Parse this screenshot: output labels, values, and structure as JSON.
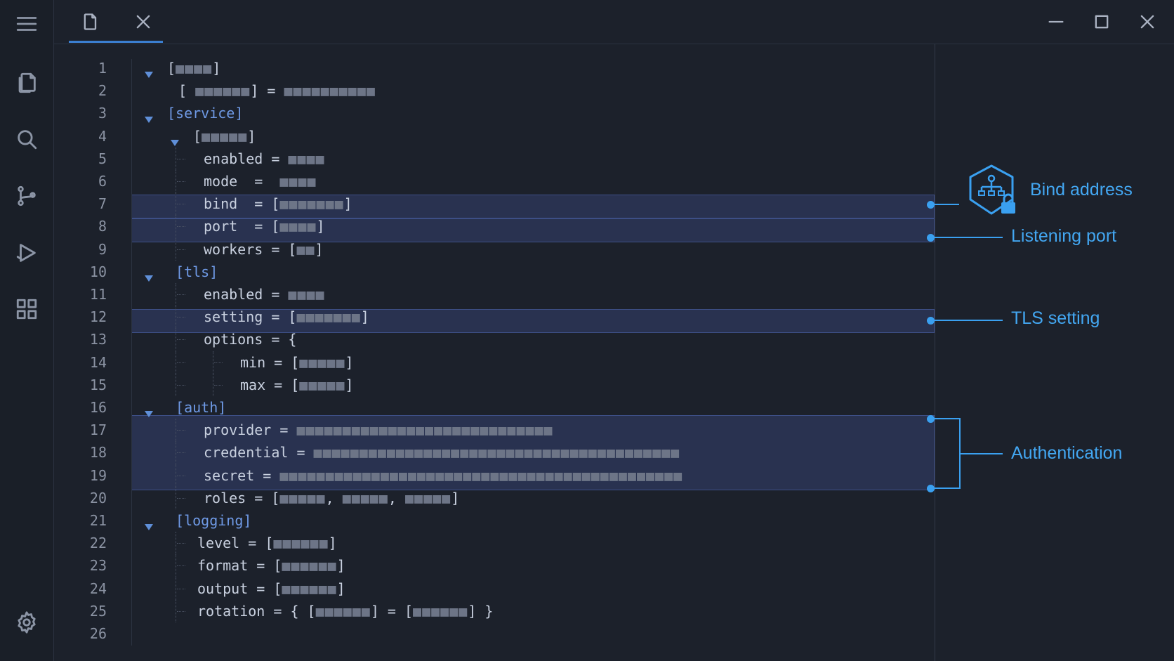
{
  "editor": {
    "lines": [
      {
        "n": "1",
        "indent": 0,
        "fold": true,
        "parts": [
          [
            "t",
            "["
          ],
          [
            "m",
            "■■■■"
          ],
          [
            "t",
            "]"
          ]
        ]
      },
      {
        "n": "2",
        "indent": 1,
        "fold": false,
        "parts": [
          [
            "t",
            "[ "
          ],
          [
            "m",
            "■■■■■■"
          ],
          [
            "t",
            "] = "
          ],
          [
            "m",
            "■■■■■■■■■■"
          ]
        ]
      },
      {
        "n": "3",
        "indent": 0,
        "fold": true,
        "parts": [
          [
            "s",
            "[service]"
          ]
        ]
      },
      {
        "n": "4",
        "indent": 1,
        "fold": true,
        "parts": [
          [
            "t",
            "["
          ],
          [
            "m",
            "■■■■■"
          ],
          [
            "t",
            "]"
          ]
        ]
      },
      {
        "n": "5",
        "indent": 2,
        "fold": false,
        "parts": [
          [
            "t",
            "enabled = "
          ],
          [
            "m",
            "■■■■"
          ]
        ]
      },
      {
        "n": "6",
        "indent": 2,
        "fold": false,
        "parts": [
          [
            "t",
            "mode  =  "
          ],
          [
            "m",
            "■■■■"
          ]
        ]
      },
      {
        "n": "7",
        "indent": 2,
        "fold": false,
        "parts": [
          [
            "t",
            "bind  = ["
          ],
          [
            "m",
            "■■■■■■■"
          ],
          [
            "t",
            "]"
          ]
        ]
      },
      {
        "n": "8",
        "indent": 2,
        "fold": false,
        "parts": [
          [
            "t",
            "port  = ["
          ],
          [
            "m",
            "■■■■"
          ],
          [
            "t",
            "]"
          ]
        ]
      },
      {
        "n": "9",
        "indent": 2,
        "fold": false,
        "parts": [
          [
            "t",
            "workers = ["
          ],
          [
            "m",
            "■■"
          ],
          [
            "t",
            "]"
          ]
        ]
      },
      {
        "n": "10",
        "indent": 0,
        "fold": true,
        "parts": [
          [
            "s",
            " [tls]"
          ]
        ]
      },
      {
        "n": "11",
        "indent": 2,
        "fold": false,
        "parts": [
          [
            "t",
            "enabled = "
          ],
          [
            "m",
            "■■■■"
          ]
        ]
      },
      {
        "n": "12",
        "indent": 2,
        "fold": false,
        "parts": [
          [
            "t",
            "setting = ["
          ],
          [
            "m",
            "■■■■■■■"
          ],
          [
            "t",
            "]"
          ]
        ]
      },
      {
        "n": "13",
        "indent": 2,
        "fold": false,
        "parts": [
          [
            "t",
            "options = {"
          ]
        ]
      },
      {
        "n": "14",
        "indent": 3,
        "fold": false,
        "parts": [
          [
            "t",
            "min = ["
          ],
          [
            "m",
            "■■■■■"
          ],
          [
            "t",
            "]"
          ]
        ]
      },
      {
        "n": "15",
        "indent": 3,
        "fold": false,
        "parts": [
          [
            "t",
            "max = ["
          ],
          [
            "m",
            "■■■■■"
          ],
          [
            "t",
            "]"
          ]
        ]
      },
      {
        "n": "16",
        "indent": 0,
        "fold": true,
        "parts": [
          [
            "s",
            " [auth]"
          ]
        ]
      },
      {
        "n": "17",
        "indent": 2,
        "fold": false,
        "parts": [
          [
            "t",
            "provider = "
          ],
          [
            "m",
            "■■■■■■■■■■■■■■■■■■■■■■■■■■■■"
          ]
        ]
      },
      {
        "n": "18",
        "indent": 2,
        "fold": false,
        "parts": [
          [
            "t",
            "credential = "
          ],
          [
            "m",
            "■■■■■■■■■■■■■■■■■■■■■■■■■■■■■■■■■■■■■■■■"
          ]
        ]
      },
      {
        "n": "19",
        "indent": 2,
        "fold": false,
        "parts": [
          [
            "t",
            "secret = "
          ],
          [
            "m",
            "■■■■■■■■■■■■■■■■■■■■■■■■■■■■■■■■■■■■■■■■■■■■"
          ]
        ]
      },
      {
        "n": "20",
        "indent": 2,
        "fold": false,
        "parts": [
          [
            "t",
            "roles = ["
          ],
          [
            "m",
            "■■■■■"
          ],
          [
            "t",
            ", "
          ],
          [
            "m",
            "■■■■■"
          ],
          [
            "t",
            ", "
          ],
          [
            "m",
            "■■■■■"
          ],
          [
            "t",
            "]"
          ]
        ]
      },
      {
        "n": "21",
        "indent": 0,
        "fold": true,
        "parts": [
          [
            "s",
            " [logging]"
          ]
        ]
      },
      {
        "n": "22",
        "indent": 1.8,
        "fold": false,
        "parts": [
          [
            "t",
            "level = ["
          ],
          [
            "m",
            "■■■■■■"
          ],
          [
            "t",
            "]"
          ]
        ]
      },
      {
        "n": "23",
        "indent": 1.8,
        "fold": false,
        "parts": [
          [
            "t",
            "format = ["
          ],
          [
            "m",
            "■■■■■■"
          ],
          [
            "t",
            "]"
          ]
        ]
      },
      {
        "n": "24",
        "indent": 1.8,
        "fold": false,
        "parts": [
          [
            "t",
            "output = ["
          ],
          [
            "m",
            "■■■■■■"
          ],
          [
            "t",
            "]"
          ]
        ]
      },
      {
        "n": "25",
        "indent": 1.8,
        "fold": false,
        "parts": [
          [
            "t",
            "rotation = { ["
          ],
          [
            "m",
            "■■■■■■"
          ],
          [
            "t",
            "] = ["
          ],
          [
            "m",
            "■■■■■■"
          ],
          [
            "t",
            "] }"
          ]
        ]
      },
      {
        "n": "26",
        "indent": 0,
        "fold": false,
        "parts": []
      }
    ]
  },
  "annotations": {
    "bind": "Bind address",
    "port": "Listening port",
    "tls": "TLS setting",
    "auth": "Authentication"
  },
  "icons": {
    "menu": "menu-icon",
    "explorer": "files-icon",
    "search": "search-icon",
    "source_control": "git-branch-icon",
    "run": "run-debug-icon",
    "extensions": "extensions-icon",
    "settings": "gear-icon",
    "file_tab": "file-icon",
    "close_tab": "close-icon",
    "minimize": "minimize-icon",
    "maximize": "maximize-icon",
    "close_window": "close-window-icon",
    "bind_badge": "network-lock-icon"
  },
  "colors": {
    "accent": "#43a7f2",
    "section": "#6f9ae6",
    "highlight": "#344270"
  }
}
